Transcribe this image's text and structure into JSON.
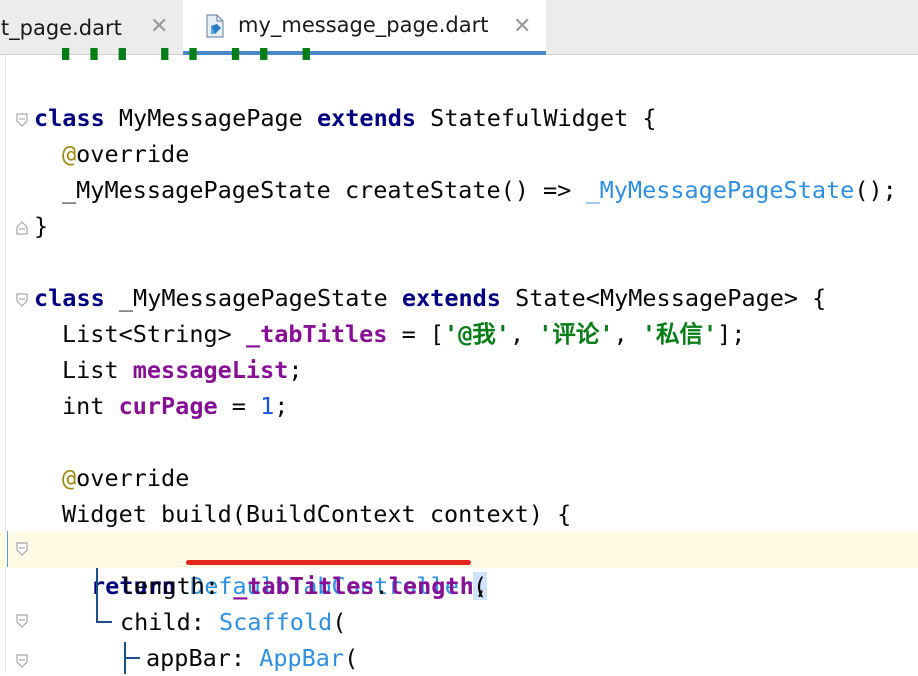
{
  "tabs": [
    {
      "label": "et_page.dart",
      "close": "✕",
      "active": false
    },
    {
      "label": "my_message_page.dart",
      "close": "✕",
      "active": true
    }
  ],
  "code": {
    "line_class1": {
      "kw": "class",
      "name": " MyMessagePage ",
      "ext": "extends",
      "rest": " StatefulWidget {"
    },
    "line_override1": {
      "at": "@",
      "rest": "override"
    },
    "line_createstate": {
      "a": "_MyMessagePageState createState() => ",
      "b": "_MyMessagePageState",
      "c": "();"
    },
    "line_close": "}",
    "line_class2": {
      "kw": "class",
      "name": " _MyMessagePageState ",
      "ext": "extends",
      "rest": " State<MyMessagePage> {"
    },
    "line_tabtitles": {
      "a": "List<String> ",
      "b": "_tabTitles",
      "c": " = [",
      "s1": "'@我'",
      "d": ", ",
      "s2": "'评论'",
      "e": ", ",
      "s3": "'私信'",
      "f": "];"
    },
    "line_messagelist": {
      "a": "List ",
      "b": "messageList",
      "c": ";"
    },
    "line_curpage": {
      "a": "int ",
      "b": "curPage",
      "c": " = ",
      "n": "1",
      "d": ";"
    },
    "line_override2": {
      "at": "@",
      "rest": "override"
    },
    "line_build": "Widget build(BuildContext context) {",
    "line_return": {
      "kw": "return",
      "sp": " ",
      "cls": "DefaultTabController",
      "paren": "("
    },
    "line_length": {
      "a": "length: ",
      "b": "_tabTitles",
      "c": ".",
      "d": "length",
      "e": ","
    },
    "line_child": {
      "a": "child: ",
      "b": "Scaffold",
      "c": "("
    },
    "line_appbar": {
      "a": "appBar: ",
      "b": "AppBar",
      "c": "("
    }
  },
  "colors": {
    "keyword": "#0033b3",
    "field": "#871094",
    "string": "#067d17",
    "class_ref": "#2f8fe0",
    "annotation": "#9e880d",
    "error_underline": "#e6261c"
  }
}
